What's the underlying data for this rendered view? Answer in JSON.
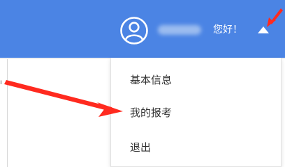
{
  "header": {
    "greeting": "您好！",
    "avatar_icon": "user-circle-icon",
    "dropdown_icon": "caret-up-icon",
    "accent_color": "#4b84e4"
  },
  "menu": {
    "items": [
      {
        "label": "基本信息"
      },
      {
        "label": "我的报考"
      },
      {
        "label": "退出"
      }
    ]
  },
  "annotations": {
    "arrow_color": "#ff2a1f"
  }
}
